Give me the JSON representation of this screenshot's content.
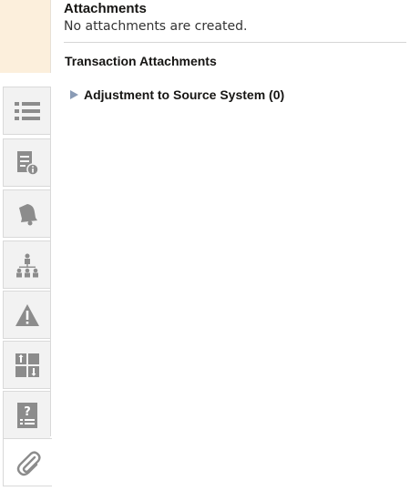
{
  "attachments": {
    "title": "Attachments",
    "message": "No attachments are created."
  },
  "transaction_attachments": {
    "title": "Transaction Attachments",
    "group_label": "Adjustment to Source System (0)"
  },
  "rail": {
    "icons": [
      "list-icon",
      "document-info-icon",
      "bell-icon",
      "hierarchy-icon",
      "warning-icon",
      "tile-grid-icon",
      "help-icon",
      "paperclip-icon"
    ],
    "active": "paperclip-icon"
  },
  "colors": {
    "rail_top_bg": "#fcefdc",
    "icon_gray": "#8c8c8c",
    "disclosure_triangle": "#8a9bb5"
  }
}
